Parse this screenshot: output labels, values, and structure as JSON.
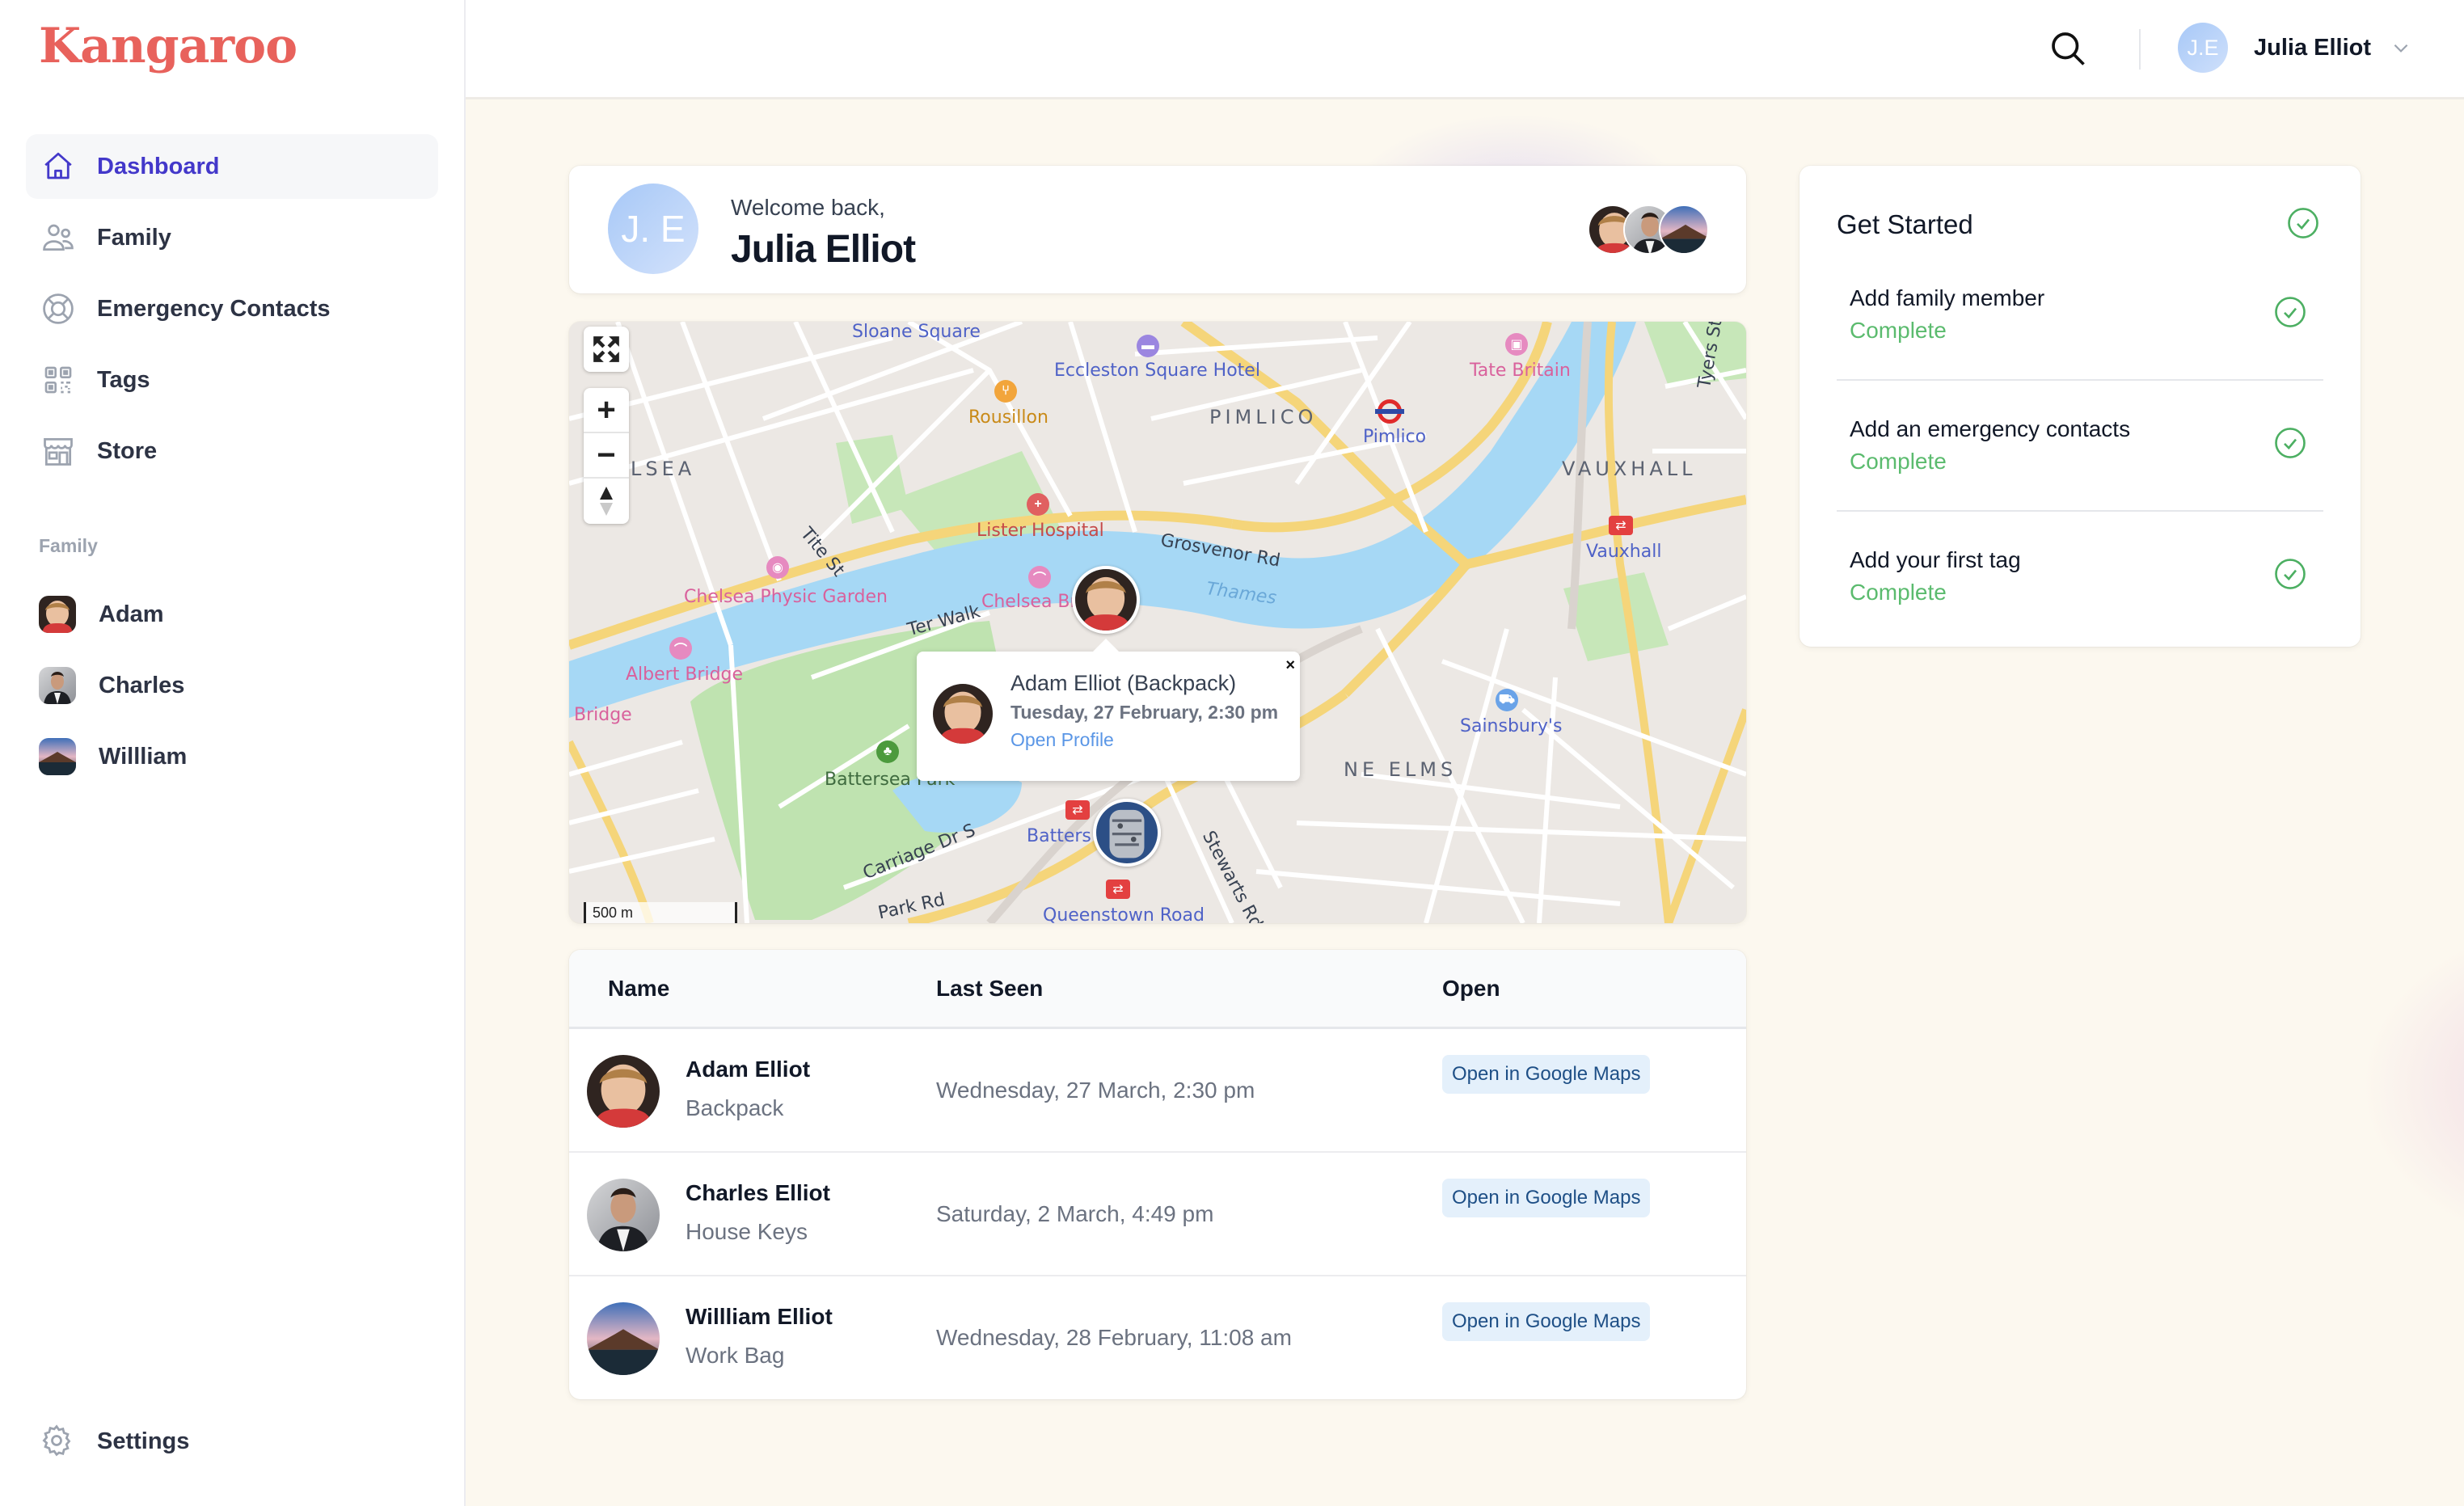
{
  "app": {
    "name": "Kangaroo",
    "brand_color": "#e8625c",
    "accent_color": "#4338ca",
    "success_color": "#5bbb6e"
  },
  "sidebar": {
    "nav": [
      {
        "label": "Dashboard",
        "icon": "home-icon",
        "active": true
      },
      {
        "label": "Family",
        "icon": "users-icon",
        "active": false
      },
      {
        "label": "Emergency Contacts",
        "icon": "lifebuoy-icon",
        "active": false
      },
      {
        "label": "Tags",
        "icon": "qr-code-icon",
        "active": false
      },
      {
        "label": "Store",
        "icon": "storefront-icon",
        "active": false
      }
    ],
    "family_section_label": "Family",
    "family": [
      {
        "name": "Adam",
        "avatar": "boy-photo"
      },
      {
        "name": "Charles",
        "avatar": "man-photo"
      },
      {
        "name": "Willliam",
        "avatar": "mountain-photo"
      }
    ],
    "settings_label": "Settings"
  },
  "header": {
    "search_icon": "search-icon",
    "user_initials": "J.E",
    "user_name": "Julia Elliot",
    "menu_icon": "chevron-down-icon"
  },
  "welcome": {
    "initials": "J. E",
    "greeting": "Welcome back,",
    "name": "Julia Elliot"
  },
  "map": {
    "controls": {
      "fullscreen": "fullscreen-icon",
      "zoom_in": "+",
      "zoom_out": "−",
      "compass": "compass-icon"
    },
    "scale_label": "500 m",
    "labels": {
      "sloane_square": "Sloane Square",
      "eccleston": "Eccleston Square Hotel",
      "rousillon": "Rousillon",
      "pimlico_area": "PIMLICO",
      "pimlico_station": "Pimlico",
      "tate_britain": "Tate Britain",
      "tyers_st": "Tyers St",
      "vauxhall_area": "VAUXHALL",
      "vauxhall_station": "Vauxhall",
      "chelsea_area": "LSEA",
      "tite_st": "Tite St",
      "lister_hospital": "Lister Hospital",
      "grosvenor_rd": "Grosvenor Rd",
      "chelsea_physic_garden": "Chelsea Physic Garden",
      "chelsea_bridge": "Chelsea Br",
      "thames": "Thames",
      "ter_walk": "Ter Walk",
      "albert_bridge": "Albert Bridge",
      "bridge": "Bridge",
      "battersea_park": "Battersea Park",
      "battersea_station": "Batters",
      "carriage_dr": "Carriage Dr S",
      "park_rd": "Park Rd",
      "queenstown_road": "Queenstown Road",
      "stewarts_rd": "Stewarts Rd",
      "nine_elms": "NE ELMS",
      "sainsburys": "Sainsbury's"
    },
    "popup": {
      "title": "Adam Elliot (Backpack)",
      "timestamp": "Tuesday, 27 February, 2:30 pm",
      "link": "Open Profile",
      "close": "×"
    }
  },
  "table": {
    "headers": [
      "Name",
      "Last Seen",
      "Open"
    ],
    "rows": [
      {
        "name": "Adam Elliot",
        "tag": "Backpack",
        "last_seen": "Wednesday, 27 March, 2:30 pm",
        "action": "Open in Google Maps"
      },
      {
        "name": "Charles Elliot",
        "tag": "House Keys",
        "last_seen": "Saturday, 2 March, 4:49 pm",
        "action": "Open in Google Maps"
      },
      {
        "name": "Willliam Elliot",
        "tag": "Work Bag",
        "last_seen": "Wednesday, 28 February, 11:08 am",
        "action": "Open in Google Maps"
      }
    ]
  },
  "get_started": {
    "title": "Get Started",
    "all_complete": true,
    "items": [
      {
        "title": "Add family member",
        "status": "Complete"
      },
      {
        "title": "Add an emergency contacts",
        "status": "Complete"
      },
      {
        "title": "Add your first tag",
        "status": "Complete"
      }
    ]
  }
}
